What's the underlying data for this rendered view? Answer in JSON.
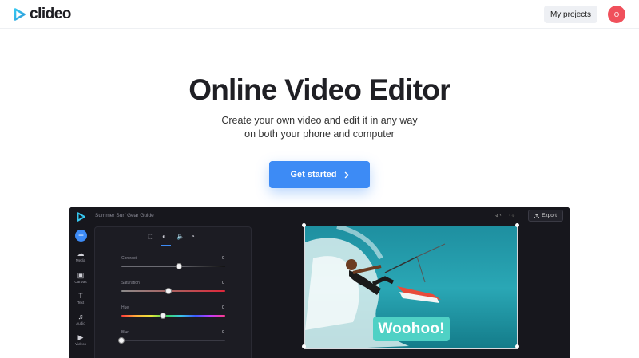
{
  "header": {
    "brand": "clideo",
    "my_projects_label": "My projects",
    "avatar_initial": "O"
  },
  "hero": {
    "title": "Online Video Editor",
    "subtitle_line1": "Create your own video and edit it in any way",
    "subtitle_line2": "on both your phone and computer",
    "cta_label": "Get started",
    "cta_icon": "chevron-right-icon"
  },
  "editor": {
    "project_title": "Summer Surf Gear Guide",
    "export_label": "Export",
    "sidebar": [
      {
        "icon": "upload-icon",
        "label": "Media"
      },
      {
        "icon": "canvas-icon",
        "label": "Canvas"
      },
      {
        "icon": "text-icon",
        "label": "Text"
      },
      {
        "icon": "audio-icon",
        "label": "Audio"
      },
      {
        "icon": "videos-icon",
        "label": "Videos"
      }
    ],
    "panel_tabs": [
      "crop-icon",
      "adjust-icon",
      "volume-icon",
      "speed-icon"
    ],
    "sliders": [
      {
        "label": "Contrast",
        "value": "0",
        "level": 0.55
      },
      {
        "label": "Saturation",
        "value": "0",
        "level": 0.45
      },
      {
        "label": "Hue",
        "value": "0",
        "level": 0.4
      },
      {
        "label": "Blur",
        "value": "0",
        "level": 0.0
      }
    ],
    "overlay_text": "Woohoo!"
  },
  "colors": {
    "accent": "#3d8bf5",
    "avatar": "#f0505b",
    "overlay": "#4fd1c5",
    "editor_bg": "#17171d"
  }
}
